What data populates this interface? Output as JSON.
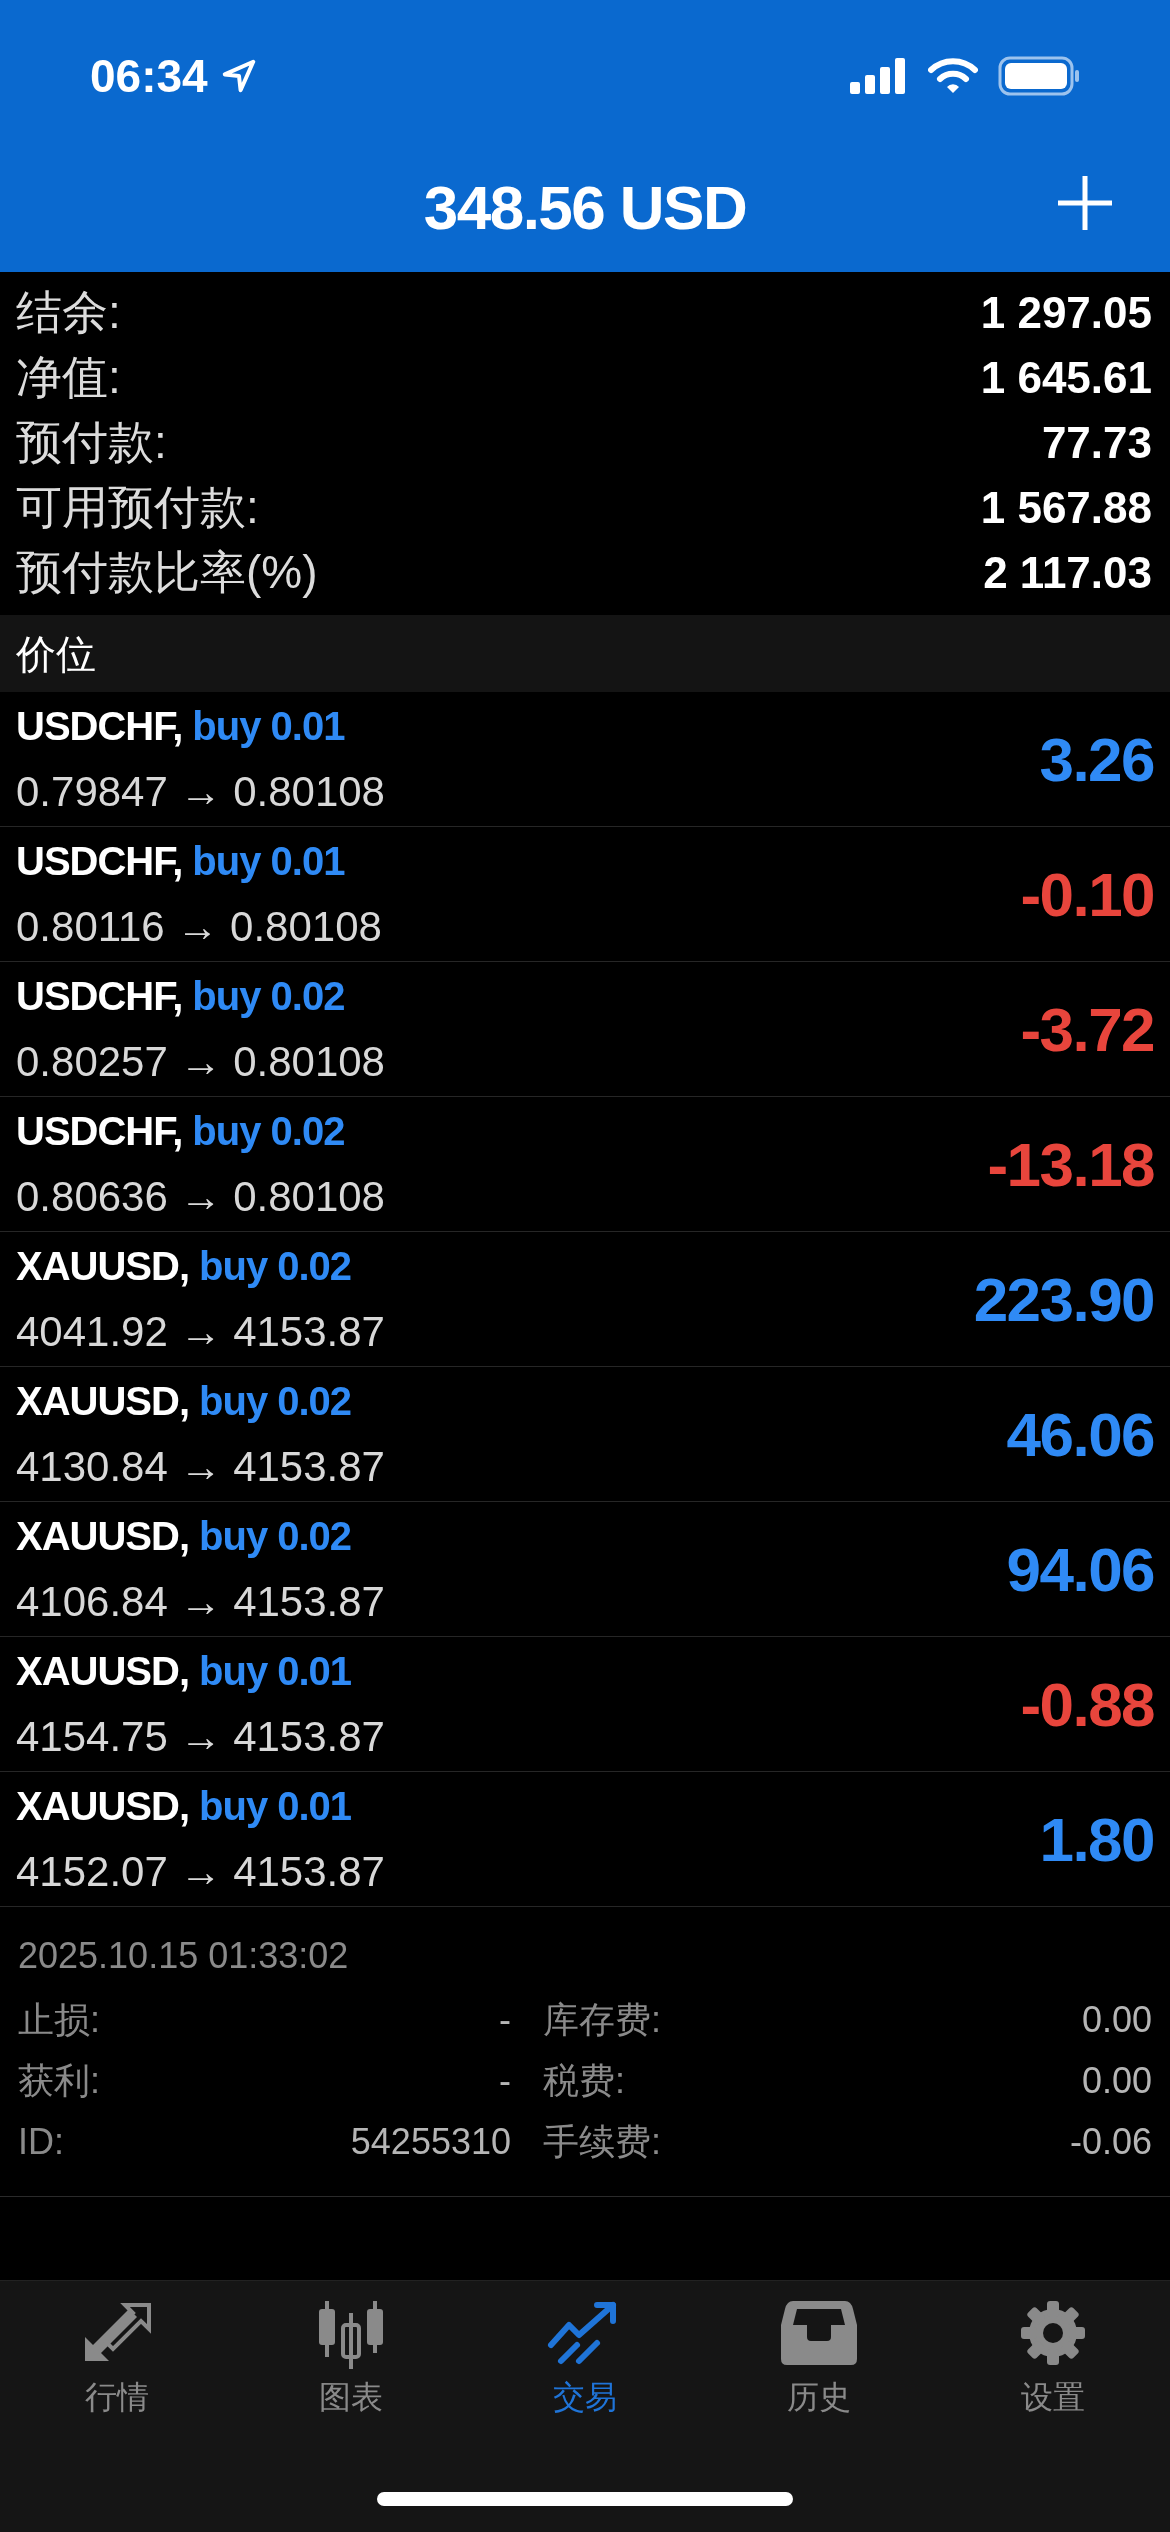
{
  "status_bar": {
    "time": "06:34"
  },
  "header": {
    "title": "348.56 USD"
  },
  "summary": [
    {
      "label": "结余:",
      "value": "1 297.05"
    },
    {
      "label": "净值:",
      "value": "1 645.61"
    },
    {
      "label": "预付款:",
      "value": "77.73"
    },
    {
      "label": "可用预付款:",
      "value": "1 567.88"
    },
    {
      "label": "预付款比率(%)",
      "value": "2 117.03"
    }
  ],
  "section": {
    "title": "价位"
  },
  "positions": [
    {
      "symbol": "USDCHF,",
      "side": "buy 0.01",
      "prices": "0.79847 → 0.80108",
      "profit": "3.26",
      "color": "#2f8af5"
    },
    {
      "symbol": "USDCHF,",
      "side": "buy 0.01",
      "prices": "0.80116 → 0.80108",
      "profit": "-0.10",
      "color": "#e8453c"
    },
    {
      "symbol": "USDCHF,",
      "side": "buy 0.02",
      "prices": "0.80257 → 0.80108",
      "profit": "-3.72",
      "color": "#e8453c"
    },
    {
      "symbol": "USDCHF,",
      "side": "buy 0.02",
      "prices": "0.80636 → 0.80108",
      "profit": "-13.18",
      "color": "#e8453c"
    },
    {
      "symbol": "XAUUSD,",
      "side": "buy 0.02",
      "prices": "4041.92 → 4153.87",
      "profit": "223.90",
      "color": "#2f8af5"
    },
    {
      "symbol": "XAUUSD,",
      "side": "buy 0.02",
      "prices": "4130.84 → 4153.87",
      "profit": "46.06",
      "color": "#2f8af5"
    },
    {
      "symbol": "XAUUSD,",
      "side": "buy 0.02",
      "prices": "4106.84 → 4153.87",
      "profit": "94.06",
      "color": "#2f8af5"
    },
    {
      "symbol": "XAUUSD,",
      "side": "buy 0.01",
      "prices": "4154.75 → 4153.87",
      "profit": "-0.88",
      "color": "#e8453c"
    },
    {
      "symbol": "XAUUSD,",
      "side": "buy 0.01",
      "prices": "4152.07 → 4153.87",
      "profit": "1.80",
      "color": "#2f8af5"
    }
  ],
  "details": {
    "time": "2025.10.15 01:33:02",
    "rows": [
      {
        "label": "止损:",
        "value": "-",
        "label_2": "库存费:",
        "value_2": "0.00"
      },
      {
        "label": "获利:",
        "value": "-",
        "label_2": "税费:",
        "value_2": "0.00"
      },
      {
        "label": "ID:",
        "value": "54255310",
        "label_2": "手续费:",
        "value_2": "-0.06"
      }
    ]
  },
  "tabs": [
    {
      "label": "行情",
      "kind": "quotes",
      "selected": false
    },
    {
      "label": "图表",
      "kind": "chart",
      "selected": false
    },
    {
      "label": "交易",
      "kind": "trade",
      "selected": true
    },
    {
      "label": "历史",
      "kind": "history",
      "selected": false
    },
    {
      "label": "设置",
      "kind": "settings",
      "selected": false
    }
  ]
}
